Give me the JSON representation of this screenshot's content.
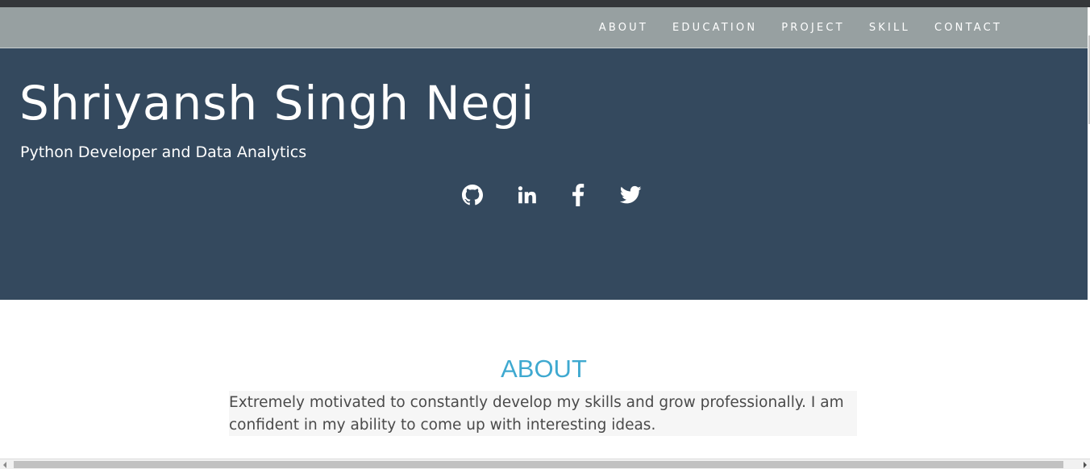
{
  "nav": {
    "items": [
      {
        "label": "ABOUT"
      },
      {
        "label": "EDUCATION"
      },
      {
        "label": "PROJECT"
      },
      {
        "label": "SKILL"
      },
      {
        "label": "CONTACT"
      }
    ]
  },
  "hero": {
    "name": "Shriyansh Singh Negi",
    "subtitle": "Python Developer and Data Analytics",
    "socials": [
      {
        "icon": "github-icon"
      },
      {
        "icon": "linkedin-icon"
      },
      {
        "icon": "facebook-icon"
      },
      {
        "icon": "twitter-icon"
      }
    ]
  },
  "about": {
    "heading": "ABOUT",
    "text": "Extremely motivated to constantly develop my skills and grow professionally. I am confident in my ability to come up with interesting ideas."
  },
  "colors": {
    "navbar": "#97a0a1",
    "hero": "#34495e",
    "accent": "#3fa9d0",
    "text": "#4a4a4a"
  }
}
